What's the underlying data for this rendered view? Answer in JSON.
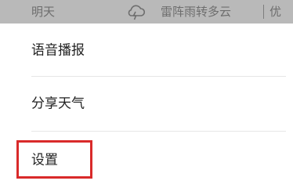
{
  "weather": {
    "day": "明天",
    "icon": "cloud-icon",
    "description": "雷阵雨转多云",
    "aqi": "优"
  },
  "menu": {
    "items": [
      {
        "label": "语音播报"
      },
      {
        "label": "分享天气"
      },
      {
        "label": "设置"
      }
    ]
  },
  "highlight": {
    "target": "设置",
    "color": "#d92a2a"
  }
}
